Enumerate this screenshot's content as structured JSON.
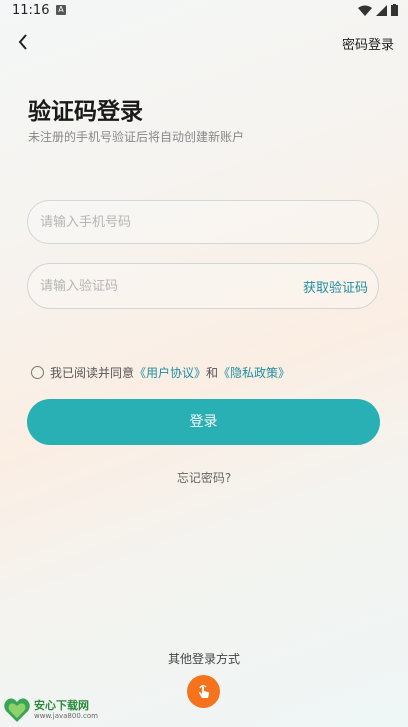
{
  "status_bar": {
    "time": "11:16",
    "notif_icon_letter": "A"
  },
  "header": {
    "password_login": "密码登录"
  },
  "title": "验证码登录",
  "subtitle": "未注册的手机号验证后将自动创建新账户",
  "phone": {
    "placeholder": "请输入手机号码",
    "value": ""
  },
  "code": {
    "placeholder": "请输入验证码",
    "value": "",
    "get_code": "获取验证码"
  },
  "agreement": {
    "prefix": "我已阅读并同意",
    "user_agreement": "《用户协议》",
    "and": "和",
    "privacy_policy": "《隐私政策》",
    "checked": false
  },
  "login_button": "登录",
  "forgot_password": "忘记密码?",
  "other_login": "其他登录方式",
  "watermark": {
    "title": "安心下载网",
    "url": "www.java800.com"
  },
  "colors": {
    "accent": "#28b0b4",
    "link": "#1f8fa1",
    "other_login_btn": "#f5731c"
  }
}
